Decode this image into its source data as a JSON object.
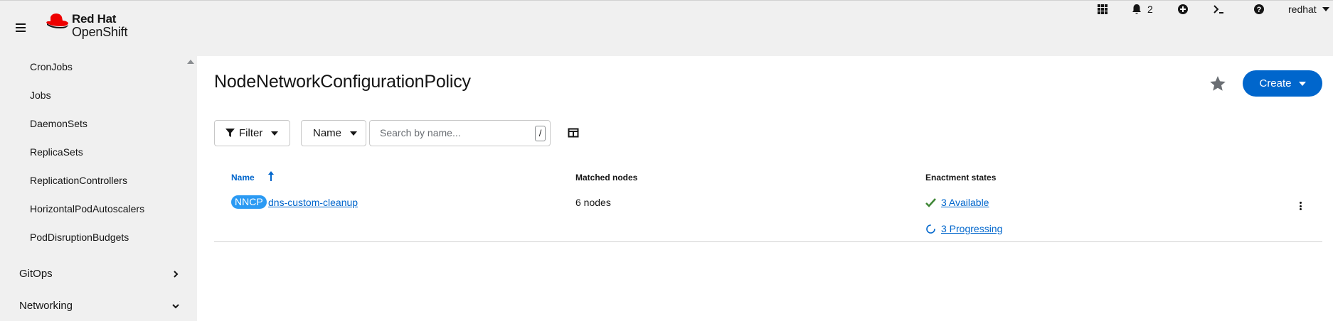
{
  "masthead": {
    "brand_line1": "Red Hat",
    "brand_line2": "OpenShift",
    "notification_count": "2",
    "user_label": "redhat",
    "icons": [
      "menu-icon",
      "app-launcher-icon",
      "bell-icon",
      "plus-circle-icon",
      "terminal-icon",
      "help-icon"
    ]
  },
  "sidebar": {
    "sub_items": [
      {
        "label": "CronJobs"
      },
      {
        "label": "Jobs"
      },
      {
        "label": "DaemonSets"
      },
      {
        "label": "ReplicaSets"
      },
      {
        "label": "ReplicationControllers"
      },
      {
        "label": "HorizontalPodAutoscalers"
      },
      {
        "label": "PodDisruptionBudgets"
      }
    ],
    "sections": [
      {
        "label": "GitOps",
        "state": "collapsed"
      },
      {
        "label": "Networking",
        "state": "expanded"
      }
    ]
  },
  "page": {
    "title": "NodeNetworkConfigurationPolicy",
    "create_label": "Create",
    "filter_label": "Filter",
    "name_select_label": "Name",
    "search_placeholder": "Search by name...",
    "search_shortcut": "/"
  },
  "table": {
    "headers": {
      "name": "Name",
      "matched": "Matched nodes",
      "states": "Enactment states"
    },
    "rows": [
      {
        "badge": "NNCP",
        "name": "dns-custom-cleanup",
        "matched": "6 nodes",
        "available": "3 Available",
        "progressing": "3 Progressing"
      }
    ]
  },
  "colors": {
    "accent": "#0066cc",
    "badge": "#2b9af3",
    "success": "#3e8635",
    "brand_red": "#ee0000"
  }
}
